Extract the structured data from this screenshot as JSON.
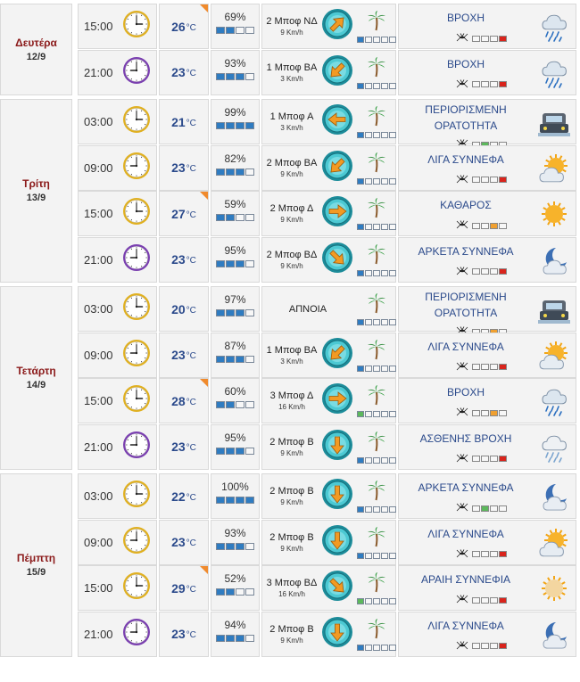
{
  "units": {
    "temp": "°C"
  },
  "colors": {
    "lvl_blue": "#2f7cc1",
    "lvl_green": "#5cb85c",
    "lvl_orange": "#f0a030",
    "lvl_red": "#d9241c",
    "hot_corner": "#f08a2c",
    "temp_text": "#2b4a8b",
    "day_text": "#8b1a1a"
  },
  "days": [
    {
      "name": "Δευτέρα",
      "date": "12/9",
      "rows": [
        {
          "time": "15:00",
          "temp": "26",
          "hot": true,
          "humidity": "69%",
          "hum_level": 2,
          "wind": "2 Μποφ ΝΔ",
          "speed": "9 Km/h",
          "dir": "ΝΔ",
          "wind_level": 1,
          "wind_color": "blue",
          "condition": [
            "ΒΡΟΧΗ"
          ],
          "icon": "rain-icon",
          "mosq_level": 3,
          "mosq_color": "red"
        },
        {
          "time": "21:00",
          "temp": "23",
          "hot": false,
          "humidity": "93%",
          "hum_level": 3,
          "wind": "1 Μποφ ΒΑ",
          "speed": "3 Km/h",
          "dir": "ΒΑ",
          "wind_level": 1,
          "wind_color": "blue",
          "condition": [
            "ΒΡΟΧΗ"
          ],
          "icon": "rain-icon",
          "mosq_level": 3,
          "mosq_color": "red"
        }
      ]
    },
    {
      "name": "Τρίτη",
      "date": "13/9",
      "rows": [
        {
          "time": "03:00",
          "temp": "21",
          "hot": false,
          "humidity": "99%",
          "hum_level": 4,
          "wind": "1 Μποφ Α",
          "speed": "3 Km/h",
          "dir": "Α",
          "wind_level": 1,
          "wind_color": "blue",
          "condition": [
            "ΠΕΡΙΟΡΙΣΜΕΝΗ",
            "ΟΡΑΤΟΤΗΤΑ"
          ],
          "icon": "fog-car-icon",
          "mosq_level": 1,
          "mosq_color": "green"
        },
        {
          "time": "09:00",
          "temp": "23",
          "hot": false,
          "humidity": "82%",
          "hum_level": 3,
          "wind": "2 Μποφ ΒΑ",
          "speed": "9 Km/h",
          "dir": "ΒΑ",
          "wind_level": 1,
          "wind_color": "blue",
          "condition": [
            "ΛΙΓΑ ΣΥΝΝΕΦΑ"
          ],
          "icon": "sun-cloud-icon",
          "mosq_level": 3,
          "mosq_color": "red"
        },
        {
          "time": "15:00",
          "temp": "27",
          "hot": true,
          "humidity": "59%",
          "hum_level": 2,
          "wind": "2 Μποφ Δ",
          "speed": "9 Km/h",
          "dir": "Δ",
          "wind_level": 1,
          "wind_color": "blue",
          "condition": [
            "ΚΑΘΑΡΟΣ"
          ],
          "icon": "sun-icon",
          "mosq_level": 2,
          "mosq_color": "orange"
        },
        {
          "time": "21:00",
          "temp": "23",
          "hot": false,
          "humidity": "95%",
          "hum_level": 3,
          "wind": "2 Μποφ ΒΔ",
          "speed": "9 Km/h",
          "dir": "ΒΔ",
          "wind_level": 1,
          "wind_color": "blue",
          "condition": [
            "ΑΡΚΕΤΑ ΣΥΝΝΕΦΑ"
          ],
          "icon": "moon-cloud-icon",
          "mosq_level": 3,
          "mosq_color": "red"
        }
      ]
    },
    {
      "name": "Τετάρτη",
      "date": "14/9",
      "rows": [
        {
          "time": "03:00",
          "temp": "20",
          "hot": false,
          "humidity": "97%",
          "hum_level": 3,
          "wind": "ΑΠΝΟΙΑ",
          "speed": "",
          "dir": "",
          "wind_level": 1,
          "wind_color": "blue",
          "condition": [
            "ΠΕΡΙΟΡΙΣΜΕΝΗ",
            "ΟΡΑΤΟΤΗΤΑ"
          ],
          "icon": "fog-car-icon",
          "mosq_level": 2,
          "mosq_color": "orange"
        },
        {
          "time": "09:00",
          "temp": "23",
          "hot": false,
          "humidity": "87%",
          "hum_level": 3,
          "wind": "1 Μποφ ΒΑ",
          "speed": "3 Km/h",
          "dir": "ΒΑ",
          "wind_level": 1,
          "wind_color": "blue",
          "condition": [
            "ΛΙΓΑ ΣΥΝΝΕΦΑ"
          ],
          "icon": "sun-cloud-icon",
          "mosq_level": 3,
          "mosq_color": "red"
        },
        {
          "time": "15:00",
          "temp": "28",
          "hot": true,
          "humidity": "60%",
          "hum_level": 2,
          "wind": "3 Μποφ Δ",
          "speed": "16 Km/h",
          "dir": "Δ",
          "wind_level": 1,
          "wind_color": "green",
          "condition": [
            "ΒΡΟΧΗ"
          ],
          "icon": "rain-icon",
          "mosq_level": 2,
          "mosq_color": "orange"
        },
        {
          "time": "21:00",
          "temp": "23",
          "hot": false,
          "humidity": "95%",
          "hum_level": 3,
          "wind": "2 Μποφ Β",
          "speed": "9 Km/h",
          "dir": "Β",
          "wind_level": 1,
          "wind_color": "blue",
          "condition": [
            "ΑΣΘΕΝΗΣ ΒΡΟΧΗ"
          ],
          "icon": "light-rain-icon",
          "mosq_level": 3,
          "mosq_color": "red"
        }
      ]
    },
    {
      "name": "Πέμπτη",
      "date": "15/9",
      "rows": [
        {
          "time": "03:00",
          "temp": "22",
          "hot": false,
          "humidity": "100%",
          "hum_level": 4,
          "wind": "2 Μποφ Β",
          "speed": "9 Km/h",
          "dir": "Β",
          "wind_level": 1,
          "wind_color": "blue",
          "condition": [
            "ΑΡΚΕΤΑ ΣΥΝΝΕΦΑ"
          ],
          "icon": "moon-cloud-icon",
          "mosq_level": 1,
          "mosq_color": "green"
        },
        {
          "time": "09:00",
          "temp": "23",
          "hot": false,
          "humidity": "93%",
          "hum_level": 3,
          "wind": "2 Μποφ Β",
          "speed": "9 Km/h",
          "dir": "Β",
          "wind_level": 1,
          "wind_color": "blue",
          "condition": [
            "ΛΙΓΑ ΣΥΝΝΕΦΑ"
          ],
          "icon": "sun-cloud-icon",
          "mosq_level": 3,
          "mosq_color": "red"
        },
        {
          "time": "15:00",
          "temp": "29",
          "hot": true,
          "humidity": "52%",
          "hum_level": 2,
          "wind": "3 Μποφ ΒΔ",
          "speed": "16 Km/h",
          "dir": "ΒΔ",
          "wind_level": 1,
          "wind_color": "green",
          "condition": [
            "ΑΡΑΙΗ ΣΥΝΝΕΦΙΑ"
          ],
          "icon": "haze-sun-icon",
          "mosq_level": 3,
          "mosq_color": "red"
        },
        {
          "time": "21:00",
          "temp": "23",
          "hot": false,
          "humidity": "94%",
          "hum_level": 3,
          "wind": "2 Μποφ Β",
          "speed": "9 Km/h",
          "dir": "Β",
          "wind_level": 1,
          "wind_color": "blue",
          "condition": [
            "ΛΙΓΑ ΣΥΝΝΕΦΑ"
          ],
          "icon": "moon-cloud-icon",
          "mosq_level": 3,
          "mosq_color": "red"
        }
      ]
    }
  ]
}
